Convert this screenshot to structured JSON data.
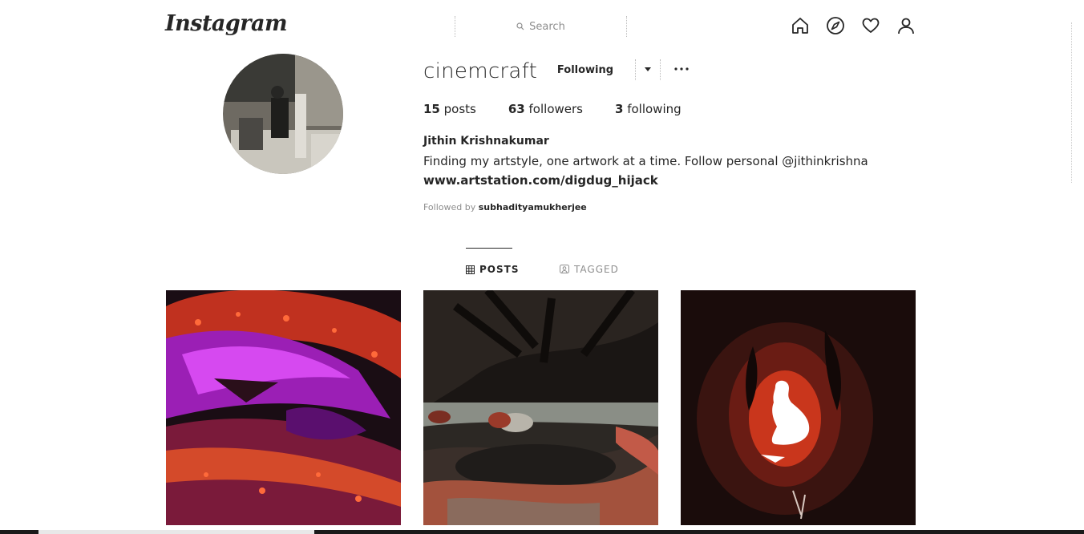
{
  "header": {
    "logo_text": "Instagram",
    "search_placeholder": "Search",
    "nav_icons": [
      "home-icon",
      "explore-compass-icon",
      "activity-heart-icon",
      "profile-icon"
    ]
  },
  "profile": {
    "username": "cinemcraft",
    "follow_state_label": "Following",
    "stats": {
      "posts_count": "15",
      "posts_label": "posts",
      "followers_count": "63",
      "followers_label": "followers",
      "following_count": "3",
      "following_label": "following"
    },
    "full_name": "Jithin Krishnakumar",
    "bio": "Finding my artstyle, one artwork at a time. Follow personal @jithinkrishna",
    "website": "www.artstation.com/digdug_hijack",
    "followed_by_prefix": "Followed by",
    "followed_by_user": "subhadityamukherjee"
  },
  "tabs": [
    {
      "label": "POSTS",
      "icon": "grid-icon",
      "active": true
    },
    {
      "label": "TAGGED",
      "icon": "tagged-user-icon",
      "active": false
    }
  ],
  "colors": {
    "text": "#262626",
    "muted": "#8e8e8e"
  }
}
